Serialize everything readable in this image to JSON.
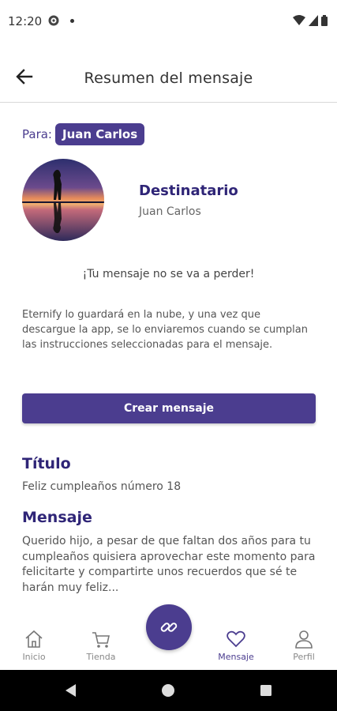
{
  "status_bar": {
    "time": "12:20",
    "icons": [
      "gear-icon",
      "dot-icon",
      "wifi-icon",
      "signal-icon",
      "battery-icon"
    ]
  },
  "app_bar": {
    "title": "Resumen del mensaje",
    "back_icon": "arrow-left-icon"
  },
  "recipient": {
    "to_label": "Para:",
    "to_name": "Juan Carlos",
    "heading": "Destinatario",
    "name": "Juan Carlos"
  },
  "notice": {
    "title": "¡Tu mensaje no se va a perder!",
    "body": "Eternify lo guardará en la nube, y una vez que descargue la app, se lo enviaremos cuando se cumplan las instrucciones seleccionadas para el mensaje."
  },
  "actions": {
    "create_label": "Crear mensaje"
  },
  "message": {
    "title_heading": "Título",
    "title_value": "Feliz cumpleaños número 18",
    "body_heading": "Mensaje",
    "body_value": "Querido hijo, a pesar de que faltan dos años para tu cumpleaños quisiera aprovechar este momento para felicitarte y compartirte unos recuerdos que sé te harán muy feliz..."
  },
  "bottom_nav": {
    "items": [
      {
        "label": "Inicio",
        "icon": "home-icon",
        "active": false
      },
      {
        "label": "Tienda",
        "icon": "cart-icon",
        "active": false
      },
      {
        "label": "Mensaje",
        "icon": "heart-icon",
        "active": true
      },
      {
        "label": "Perfil",
        "icon": "person-icon",
        "active": false
      }
    ],
    "fab_icon": "link-icon"
  },
  "colors": {
    "primary": "#4b3d8f",
    "heading": "#2f2577",
    "text": "#555555"
  }
}
